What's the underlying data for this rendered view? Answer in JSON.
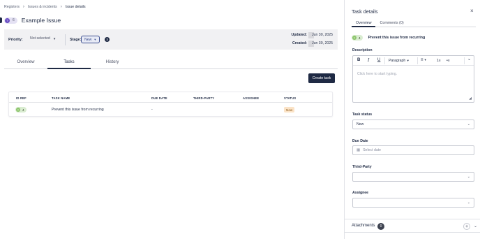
{
  "breadcrumb": {
    "items": [
      "Registers",
      "Issues & incidents",
      "Issue details"
    ]
  },
  "issue": {
    "badge_icon": "?",
    "badge_num": "6",
    "title": "Example Issue"
  },
  "meta": {
    "priority_label": "Priority:",
    "priority_value": "Not selected",
    "stage_label": "Stage:",
    "stage_value": "New",
    "info_icon": "i",
    "updated_label": "Updated:",
    "updated_value": "Jun 30, 2025",
    "created_label": "Created:",
    "created_value": "Jun 30, 2025"
  },
  "tabs": [
    "Overview",
    "Tasks",
    "History"
  ],
  "create_task_label": "Create task",
  "table": {
    "headers": [
      "ID REF",
      "TASK NAME",
      "DUE DATE",
      "THIRD-PARTY",
      "ASSIGNEE",
      "STATUS"
    ],
    "rows": [
      {
        "id_icon": "T",
        "id_num": "4",
        "task_name": "Prevent this issue from recurring",
        "due_date": "-",
        "third_party": "",
        "assignee": "",
        "status": "New"
      }
    ]
  },
  "panel": {
    "title": "Task details",
    "close_icon": "×",
    "tabs": [
      "Overview",
      "Comments (0)"
    ],
    "task_badge_icon": "T",
    "task_badge_num": "4",
    "task_name": "Prevent this issue from recurring",
    "description_label": "Description",
    "toolbar": {
      "bold": "B",
      "italic": "I",
      "underline": "U",
      "paragraph": "Paragraph",
      "align": "≡",
      "ordered_list": "1≡",
      "bullet_list": "•≡",
      "more": "⌄"
    },
    "editor_placeholder": "Click here to start typing.",
    "status_label": "Task status",
    "status_value": "New",
    "due_label": "Due Date",
    "due_placeholder": "Select date",
    "third_party_label": "Third-Party",
    "third_party_value": "",
    "assignee_label": "Assignee",
    "assignee_value": "",
    "attachments_label": "Attachments",
    "attachments_count": "0"
  },
  "colors": {
    "navy": "#1f2a44",
    "purple_badge": "#6b4fc4",
    "green_badge": "#8cc56b",
    "status_new_bg": "#fbe3c7"
  }
}
